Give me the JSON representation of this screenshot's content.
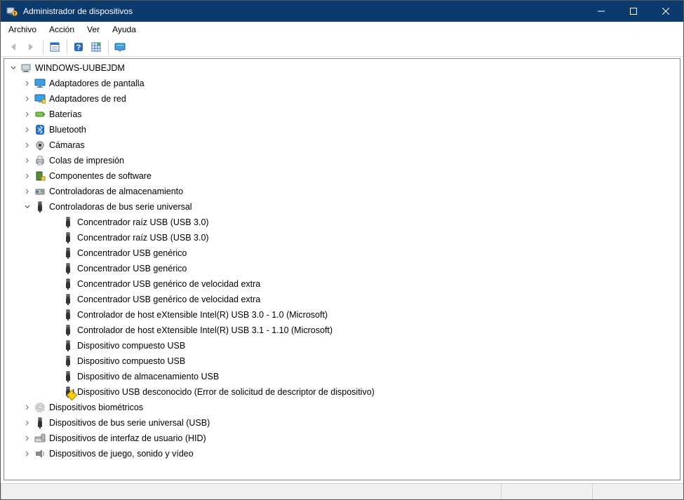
{
  "window": {
    "title": "Administrador de dispositivos"
  },
  "menu": {
    "file": "Archivo",
    "action": "Acción",
    "view": "Ver",
    "help": "Ayuda"
  },
  "tree": {
    "root": "WINDOWS-UUBEJDM",
    "categories": [
      {
        "label": "Adaptadores de pantalla",
        "icon": "display",
        "expanded": false
      },
      {
        "label": "Adaptadores de red",
        "icon": "network",
        "expanded": false
      },
      {
        "label": "Baterías",
        "icon": "battery",
        "expanded": false
      },
      {
        "label": "Bluetooth",
        "icon": "bluetooth",
        "expanded": false
      },
      {
        "label": "Cámaras",
        "icon": "camera",
        "expanded": false
      },
      {
        "label": "Colas de impresión",
        "icon": "printer",
        "expanded": false
      },
      {
        "label": "Componentes de software",
        "icon": "software",
        "expanded": false
      },
      {
        "label": "Controladoras de almacenamiento",
        "icon": "storage",
        "expanded": false
      },
      {
        "label": "Controladoras de bus serie universal",
        "icon": "usb",
        "expanded": true,
        "children": [
          {
            "label": "Concentrador raíz USB (USB 3.0)",
            "icon": "usb"
          },
          {
            "label": "Concentrador raíz USB (USB 3.0)",
            "icon": "usb"
          },
          {
            "label": "Concentrador USB genérico",
            "icon": "usb"
          },
          {
            "label": "Concentrador USB genérico",
            "icon": "usb"
          },
          {
            "label": "Concentrador USB genérico de velocidad extra",
            "icon": "usb"
          },
          {
            "label": "Concentrador USB genérico de velocidad extra",
            "icon": "usb"
          },
          {
            "label": "Controlador de host eXtensible Intel(R) USB 3.0 - 1.0 (Microsoft)",
            "icon": "usb"
          },
          {
            "label": "Controlador de host eXtensible Intel(R) USB 3.1 - 1.10 (Microsoft)",
            "icon": "usb"
          },
          {
            "label": "Dispositivo compuesto USB",
            "icon": "usb"
          },
          {
            "label": "Dispositivo compuesto USB",
            "icon": "usb"
          },
          {
            "label": "Dispositivo de almacenamiento USB",
            "icon": "usb"
          },
          {
            "label": "Dispositivo USB desconocido (Error de solicitud de descriptor de dispositivo)",
            "icon": "usb",
            "warning": true
          }
        ]
      },
      {
        "label": "Dispositivos biométricos",
        "icon": "biometric",
        "expanded": false
      },
      {
        "label": "Dispositivos de bus serie universal (USB)",
        "icon": "usb",
        "expanded": false
      },
      {
        "label": "Dispositivos de interfaz de usuario (HID)",
        "icon": "hid",
        "expanded": false
      },
      {
        "label": "Dispositivos de juego, sonido y vídeo",
        "icon": "sound",
        "expanded": false
      }
    ]
  }
}
